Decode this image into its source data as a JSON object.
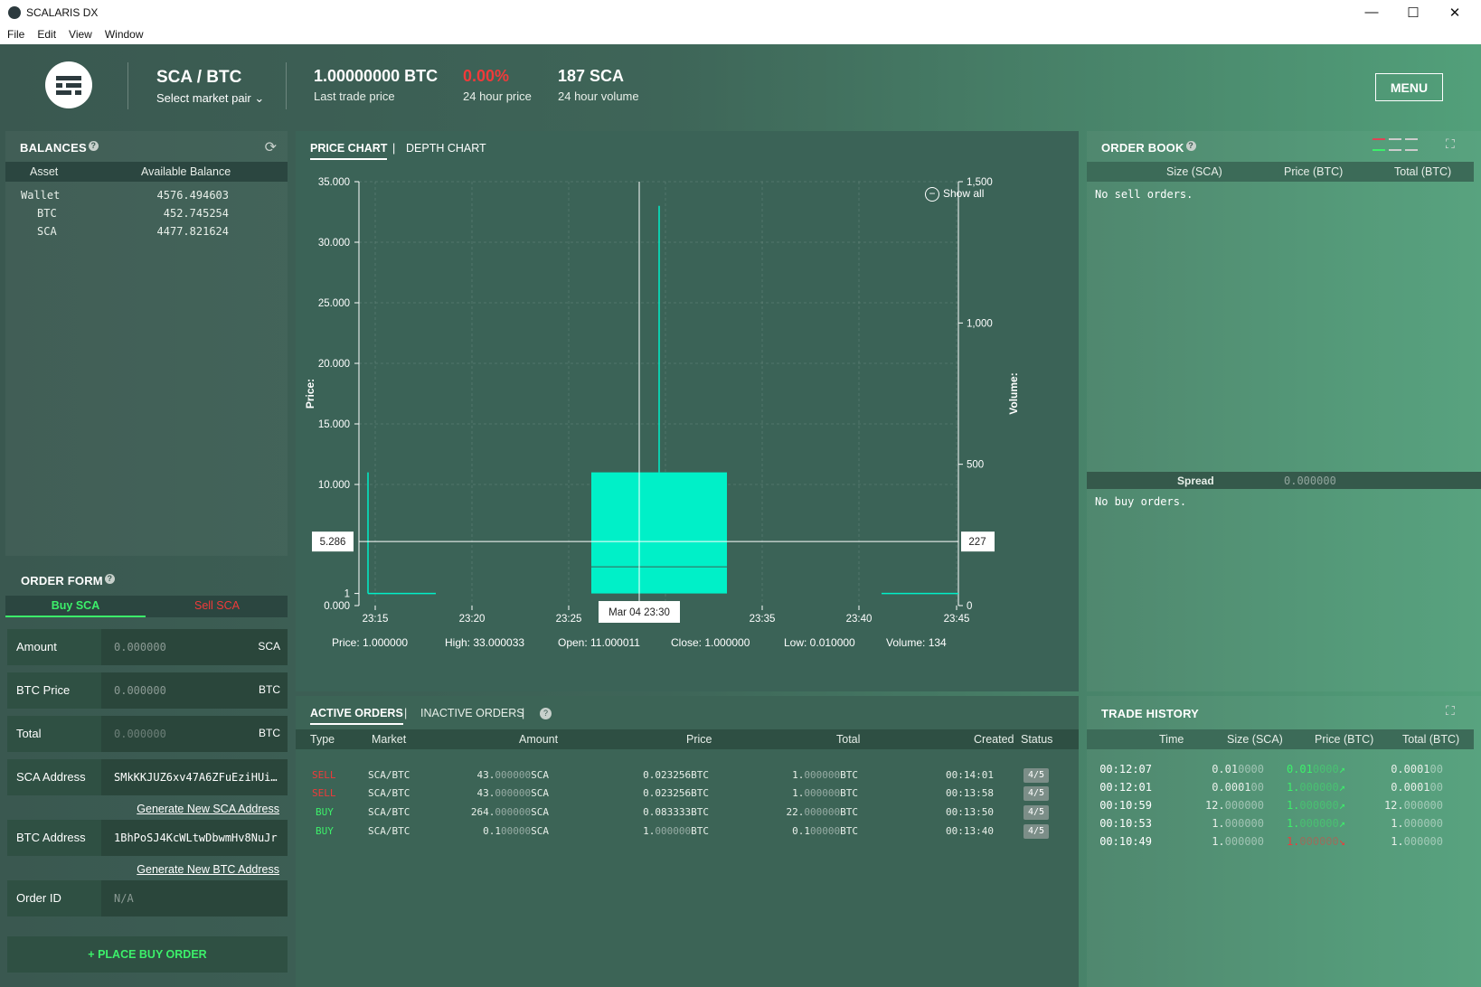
{
  "window": {
    "title": "SCALARIS DX",
    "minimize": "—",
    "maximize": "☐",
    "close": "✕"
  },
  "menubar": [
    "File",
    "Edit",
    "View",
    "Window"
  ],
  "header": {
    "pair": "SCA / BTC",
    "select_pair": "Select market pair ⌄",
    "last_price": "1.00000000 BTC",
    "last_price_label": "Last trade price",
    "change": "0.00%",
    "change_label": "24 hour price",
    "volume": "187 SCA",
    "volume_label": "24 hour volume",
    "menu": "MENU"
  },
  "balances": {
    "title": "BALANCES",
    "col_asset": "Asset",
    "col_balance": "Available Balance",
    "rows": [
      {
        "asset": "Wallet",
        "balance": "4576.494603"
      },
      {
        "asset": "BTC",
        "balance": "452.745254"
      },
      {
        "asset": "SCA",
        "balance": "4477.821624"
      }
    ]
  },
  "order_form": {
    "title": "ORDER FORM",
    "tab_buy": "Buy SCA",
    "tab_sell": "Sell SCA",
    "amount_label": "Amount",
    "amount_value": "0.000000",
    "amount_unit": "SCA",
    "price_label": "BTC Price",
    "price_value": "0.000000",
    "price_unit": "BTC",
    "total_label": "Total",
    "total_value": "0.000000",
    "total_unit": "BTC",
    "sca_addr_label": "SCA Address",
    "sca_addr_value": "SMkKKJUZ6xv47A6ZFuEziHUi…",
    "gen_sca": "Generate New SCA Address",
    "btc_addr_label": "BTC Address",
    "btc_addr_value": "1BhPoSJ4KcWLtwDbwmHv8NuJr",
    "gen_btc": "Generate New BTC Address",
    "order_id_label": "Order ID",
    "order_id_value": "N/A",
    "place": "+ PLACE BUY ORDER"
  },
  "chart_tabs": {
    "price": "PRICE CHART",
    "sep": "|",
    "depth": "DEPTH CHART",
    "show_all": "Show all"
  },
  "chart_data": {
    "type": "candlestick",
    "x_ticks": [
      "23:15",
      "23:20",
      "23:25",
      "23:30",
      "23:35",
      "23:40",
      "23:45"
    ],
    "y_ticks": [
      "35.000",
      "30.000",
      "25.000",
      "20.000",
      "15.000",
      "10.000",
      "5.286",
      "1",
      "0.000"
    ],
    "y_label": "Price:",
    "y2_ticks": [
      "1,500",
      "1,000",
      "500",
      "227",
      "0"
    ],
    "y2_label": "Volume:",
    "ylim": [
      0,
      35
    ],
    "y2lim": [
      0,
      1500
    ],
    "crosshair": {
      "x": "Mar 04 23:30",
      "price": "5.286",
      "volume": "227"
    },
    "candles": [
      {
        "time": "23:15",
        "open": 1,
        "high": 11,
        "low": 1,
        "close": 1
      },
      {
        "time": "23:30",
        "open": 11.000011,
        "high": 33.000033,
        "low": 0.01,
        "close": 1.0
      }
    ],
    "readout": {
      "price": "Price: 1.000000",
      "high": "High: 33.000033",
      "open": "Open: 11.000011",
      "close": "Close: 1.000000",
      "low": "Low: 0.010000",
      "volume": "Volume: 134"
    }
  },
  "order_book": {
    "title": "ORDER BOOK",
    "col_size": "Size (SCA)",
    "col_price": "Price (BTC)",
    "col_total": "Total (BTC)",
    "no_sell": "No sell orders.",
    "spread_label": "Spread",
    "spread_value": "0.000000",
    "no_buy": "No buy orders."
  },
  "orders": {
    "tab_active": "ACTIVE ORDERS",
    "tab_inactive": "INACTIVE ORDERS",
    "sep": "|",
    "cols": {
      "type": "Type",
      "market": "Market",
      "amount": "Amount",
      "price": "Price",
      "total": "Total",
      "created": "Created",
      "status": "Status"
    },
    "rows": [
      {
        "type": "SELL",
        "market": "SCA/BTC",
        "amount_a": "43.",
        "amount_b": "000000",
        "amount_u": "SCA",
        "price": "0.023256BTC",
        "total_a": "1.",
        "total_b": "000000",
        "total_u": "BTC",
        "created": "00:14:01",
        "status": "4/5"
      },
      {
        "type": "SELL",
        "market": "SCA/BTC",
        "amount_a": "43.",
        "amount_b": "000000",
        "amount_u": "SCA",
        "price": "0.023256BTC",
        "total_a": "1.",
        "total_b": "000000",
        "total_u": "BTC",
        "created": "00:13:58",
        "status": "4/5"
      },
      {
        "type": "BUY",
        "market": "SCA/BTC",
        "amount_a": "264.",
        "amount_b": "000000",
        "amount_u": "SCA",
        "price": "0.083333BTC",
        "total_a": "22.",
        "total_b": "000000",
        "total_u": "BTC",
        "created": "00:13:50",
        "status": "4/5"
      },
      {
        "type": "BUY",
        "market": "SCA/BTC",
        "amount_a": "0.1",
        "amount_b": "00000",
        "amount_u": "SCA",
        "price_a": "1.",
        "price_b": "000000",
        "price_u": "BTC",
        "total_a": "0.1",
        "total_b": "00000",
        "total_u": "BTC",
        "created": "00:13:40",
        "status": "4/5"
      }
    ]
  },
  "trade_history": {
    "title": "TRADE HISTORY",
    "col_time": "Time",
    "col_size": "Size (SCA)",
    "col_price": "Price (BTC)",
    "col_total": "Total (BTC)",
    "rows": [
      {
        "time": "00:12:07",
        "size_a": "0.01",
        "size_b": "0000",
        "price_a": "0.01",
        "price_b": "0000",
        "dir": "↗",
        "total_a": "0.0001",
        "total_b": "00"
      },
      {
        "time": "00:12:01",
        "size_a": "0.0001",
        "size_b": "00",
        "price_a": "1.",
        "price_b": "000000",
        "dir": "↗",
        "total_a": "0.0001",
        "total_b": "00"
      },
      {
        "time": "00:10:59",
        "size_a": "12.",
        "size_b": "000000",
        "price_a": "1.",
        "price_b": "000000",
        "dir": "↗",
        "total_a": "12.",
        "total_b": "000000"
      },
      {
        "time": "00:10:53",
        "size_a": "1.",
        "size_b": "000000",
        "price_a": "1.",
        "price_b": "000000",
        "dir": "↗",
        "total_a": "1.",
        "total_b": "000000"
      },
      {
        "time": "00:10:49",
        "size_a": "1.",
        "size_b": "000000",
        "price_a": "1.",
        "price_b": "000000",
        "dir": "↘",
        "total_a": "1.",
        "total_b": "000000"
      }
    ]
  },
  "colors": {
    "accent": "#3cf06a",
    "sell": "#f03a3a",
    "candle": "#00f0c8"
  }
}
